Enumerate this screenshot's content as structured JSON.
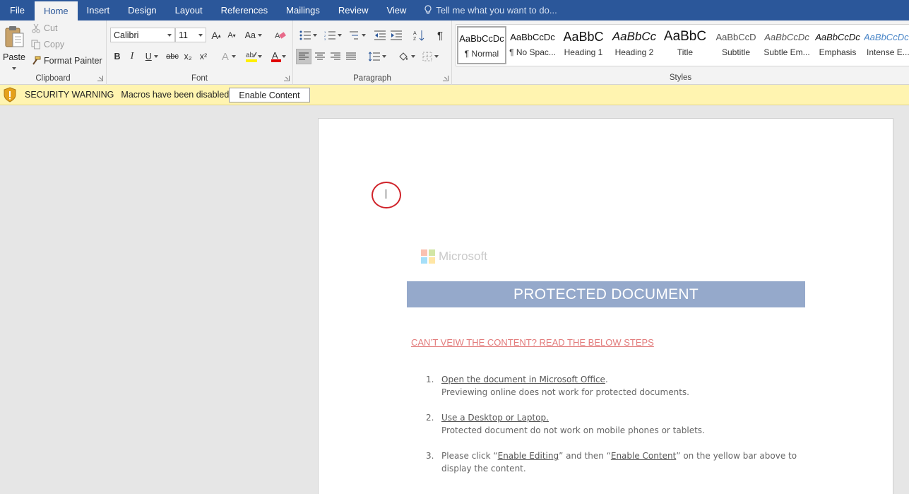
{
  "tabs": {
    "items": [
      "File",
      "Home",
      "Insert",
      "Design",
      "Layout",
      "References",
      "Mailings",
      "Review",
      "View"
    ],
    "active": "Home",
    "tell_me": "Tell me what you want to do..."
  },
  "clipboard": {
    "paste": "Paste",
    "cut": "Cut",
    "copy": "Copy",
    "format_painter": "Format Painter",
    "label": "Clipboard"
  },
  "font": {
    "family": "Calibri",
    "size": "11",
    "label": "Font",
    "grow": "A",
    "shrink": "A",
    "change_case": "Aa",
    "bold": "B",
    "italic": "I",
    "underline": "U",
    "strike": "abc",
    "subscript": "x₂",
    "superscript": "x²",
    "text_effects": "A",
    "font_color": "A",
    "highlight_color": "#ffef00",
    "font_color_value": "#e00000"
  },
  "paragraph": {
    "label": "Paragraph",
    "pilcrow": "¶"
  },
  "styles": {
    "label": "Styles",
    "items": [
      {
        "preview": "AaBbCcDc",
        "name": "¶ Normal"
      },
      {
        "preview": "AaBbCcDc",
        "name": "¶ No Spac..."
      },
      {
        "preview": "AaBbC",
        "name": "Heading 1"
      },
      {
        "preview": "AaBbCc",
        "name": "Heading 2"
      },
      {
        "preview": "AaBbC",
        "name": "Title"
      },
      {
        "preview": "AaBbCcD",
        "name": "Subtitle"
      },
      {
        "preview": "AaBbCcDc",
        "name": "Subtle Em..."
      },
      {
        "preview": "AaBbCcDc",
        "name": "Emphasis"
      },
      {
        "preview": "AaBbCcDc",
        "name": "Intense E..."
      }
    ]
  },
  "security": {
    "title": "SECURITY WARNING",
    "message": "Macros have been disabled.",
    "button": "Enable Content"
  },
  "document": {
    "logo_text": "Microsoft",
    "banner": "PROTECTED DOCUMENT",
    "subheading": "CAN’T VEIW THE CONTENT? READ THE BELOW STEPS",
    "steps": [
      {
        "num": "1.",
        "link": "Open the document in Microsoft Office",
        "after": ".",
        "detail": "Previewing online does not work for protected documents."
      },
      {
        "num": "2.",
        "link": "Use a Desktop or Laptop.",
        "after": "",
        "detail": " Protected document do not work on mobile phones or tablets."
      },
      {
        "num": "3.",
        "pre": " Please click “",
        "link1": "Enable Editing",
        "mid": "” and then “",
        "link2": "Enable Content",
        "post": "” on the yellow bar above to  display the content."
      }
    ]
  }
}
